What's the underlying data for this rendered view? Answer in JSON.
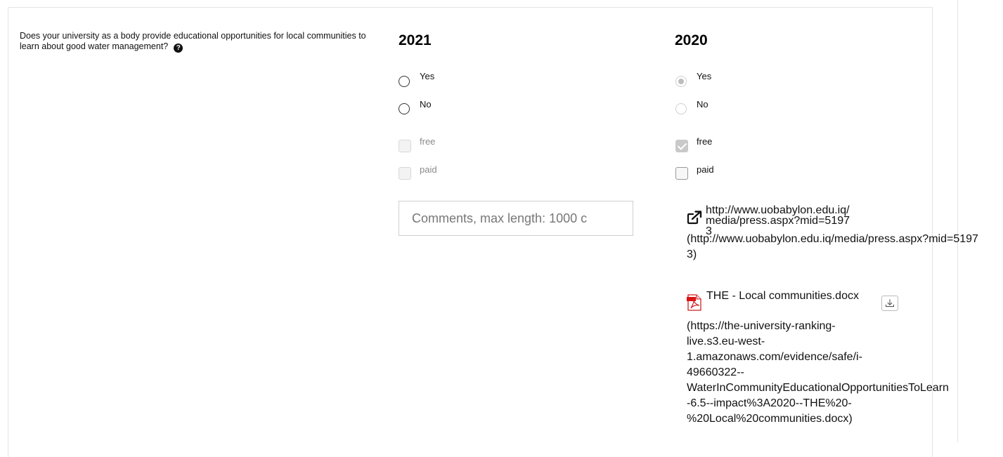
{
  "question": {
    "text": "Does your university as a body provide educational opportunities for local communities to learn about good water management?",
    "help_icon": "question-circle-icon"
  },
  "columns": [
    {
      "year": "2021",
      "options": [
        {
          "label": "Yes",
          "selected": false,
          "enabled": true
        },
        {
          "label": "No",
          "selected": false,
          "enabled": true
        }
      ],
      "checkboxes": [
        {
          "label": "free",
          "checked": false,
          "enabled": false
        },
        {
          "label": "paid",
          "checked": false,
          "enabled": false
        }
      ],
      "comments_placeholder": "Comments, max length: 1000 c"
    },
    {
      "year": "2020",
      "options": [
        {
          "label": "Yes",
          "selected": true,
          "enabled": false
        },
        {
          "label": "No",
          "selected": false,
          "enabled": false
        }
      ],
      "checkboxes": [
        {
          "label": "free",
          "checked": true,
          "enabled": false
        },
        {
          "label": "paid",
          "checked": false,
          "enabled": true
        }
      ],
      "evidence": {
        "link": {
          "icon": "external-link-icon",
          "title": "http://www.uobabylon.edu.iq/media/press.aspx?mid=51973",
          "url": "(http://www.uobabylon.edu.iq/media/press.aspx?mid=51973)"
        },
        "file": {
          "icon": "pdf-file-icon",
          "title": "THE - Local communities.docx",
          "download_icon": "download-icon",
          "url_lines": [
            "(https://the-university-ranking-",
            "live.s3.eu-west-",
            "1.amazonaws.com/evidence/safe/i-",
            "49660322--",
            "WaterInCommunityEducationalOpportunitiesToLearn",
            "-6.5--impact%3A2020--THE%20-",
            "%20Local%20communities.docx)"
          ]
        }
      }
    }
  ],
  "colors": {
    "border": "#e4e4e4",
    "text": "#111111",
    "disabled_text": "#8a8a8a"
  }
}
